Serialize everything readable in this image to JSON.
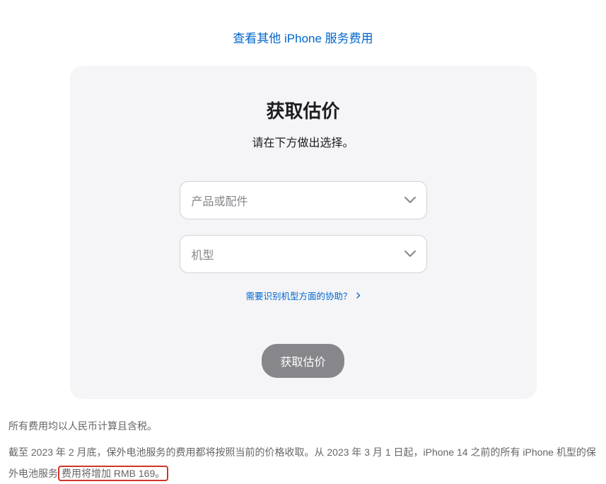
{
  "topLink": {
    "label": "查看其他 iPhone 服务费用"
  },
  "card": {
    "title": "获取估价",
    "subtitle": "请在下方做出选择。",
    "select1": {
      "placeholder": "产品或配件"
    },
    "select2": {
      "placeholder": "机型"
    },
    "helpLink": {
      "label": "需要识别机型方面的协助？"
    },
    "submit": {
      "label": "获取估价"
    }
  },
  "footer": {
    "line1": "所有费用均以人民币计算且含税。",
    "line2_part1": "截至 2023 年 2 月底，保外电池服务的费用都将按照当前的价格收取。从 2023 年 3 月 1 日起，iPhone 14 之前的所有 iPhone 机型的保外电池服务",
    "line2_highlight": "费用将增加 RMB 169。"
  }
}
